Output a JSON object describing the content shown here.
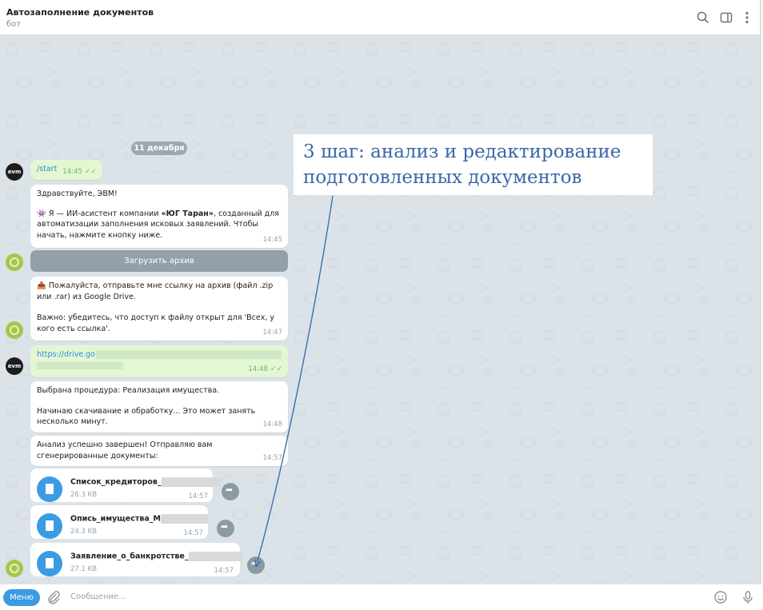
{
  "header": {
    "title": "Автозаполнение документов",
    "subtitle": "бот"
  },
  "chat": {
    "date": "11 декабря",
    "msg_start": {
      "text": "/start",
      "time": "14:45"
    },
    "msg_greet": {
      "line1": "Здравствуйте, ЭВМ!",
      "line2a": "👾 Я — ИИ-асистент компании ",
      "line2b": "«ЮГ Таран»",
      "line2c": ", созданный для автоматизации заполнения исковых заявлений. Чтобы начать, нажмите кнопку ниже.",
      "time": "14:45"
    },
    "button_archive": "Загрузить архив",
    "msg_link_req": {
      "line1": "📤 Пожалуйста, отправьте мне ссылку на архив (файл .zip или .rar) из Google Drive.",
      "line2": "Важно: убедитесь, что доступ к файлу открыт для 'Всех, у кого есть ссылка'.",
      "time": "14:47"
    },
    "msg_link": {
      "text": "https://drive.go",
      "time": "14:48"
    },
    "msg_proc": {
      "line1": "Выбрана процедура: Реализация имущества.",
      "line2": "Начинаю скачивание и обработку... Это может занять несколько минут.",
      "time": "14:48"
    },
    "msg_done": {
      "text": "Анализ успешно завершен! Отправляю вам сгенерированные документы:",
      "time": "14:57"
    },
    "files": [
      {
        "name": "Список_кредиторов_",
        "size": "26.3 KB",
        "time": "14:57"
      },
      {
        "name": "Опись_имущества_М",
        "size": "24.3 KB",
        "time": "14:57"
      },
      {
        "name": "Заявление_о_банкротстве_",
        "size": "27.1 KB",
        "time": "14:57"
      }
    ],
    "avatar_user": "evm"
  },
  "annotation": {
    "text": "3 шаг: анализ и редактирование подготовленных документов"
  },
  "input": {
    "menu_label": "Меню",
    "placeholder": "Сообщение..."
  },
  "colors": {
    "accent": "#3b9be3",
    "annotation": "#3a68a8",
    "chat_bg": "#dce3e8",
    "outgoing": "#e3f7d3"
  }
}
